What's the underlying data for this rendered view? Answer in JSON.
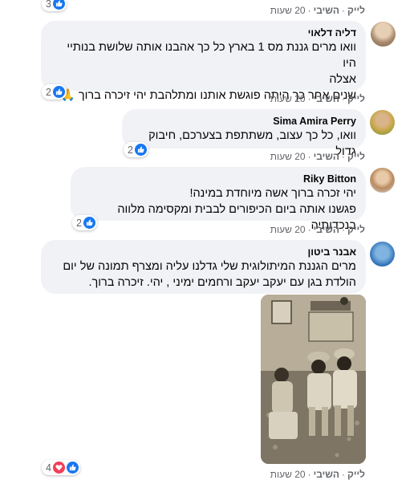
{
  "colors": {
    "bubble": "#f0f2f5",
    "like_blue": "#1877f2",
    "love_red": "#f33e58",
    "meta_gray": "#65676b"
  },
  "top": {
    "reaction_count": "3",
    "like_label": "לייק",
    "reply_label": "השיבי",
    "time": "20 שעות"
  },
  "comments": [
    {
      "author": "דליה דלאוי",
      "lines": [
        "וואו מרים גננת מס 1 בארץ כל כך אהבנו אותה שלושת בנותיי היו",
        "אצלה",
        "שנים אחר כך היתה פוגשת אותנו ומתלהבת יהי זיכרה ברוך 🙏"
      ],
      "reaction_count": "2",
      "like_label": "לייק",
      "reply_label": "השיבי",
      "time": "20 שעות"
    },
    {
      "author": "Sima Amira Perry",
      "lines": [
        "וואו, כל כך עצוב, משתתפת בצערכם, חיבוק גדול"
      ],
      "reaction_count": "2",
      "like_label": "לייק",
      "reply_label": "השיבי",
      "time": "20 שעות"
    },
    {
      "author": "Riky Bitton",
      "lines": [
        "יהי זכרה ברוך אשה מיוחדת במינה!",
        "פגשנו אותה ביום הכיפורים לבבית ומקסימה מלווה בנכדותיה"
      ],
      "reaction_count": "2",
      "like_label": "לייק",
      "reply_label": "השיבי",
      "time": "20 שעות"
    },
    {
      "author": "אבנר ביטון",
      "lines": [
        "מרים הגננת המיתולוגית שלי גדלנו עליה ומצרף תמונה של יום",
        "הולדת בגן עם יעקב יעקב ורחמים ימיני , יהי. זיכרה ברוך."
      ],
      "reaction_count": "4",
      "like_label": "לייק",
      "reply_label": "השיבי",
      "time": "20 שעות"
    }
  ]
}
